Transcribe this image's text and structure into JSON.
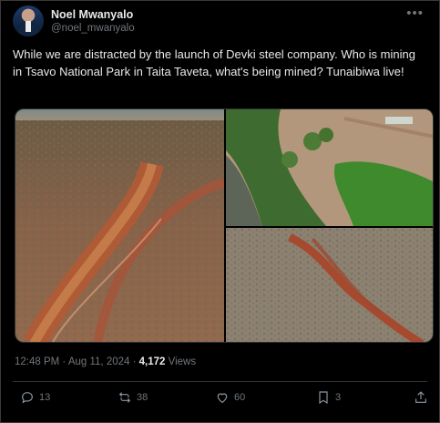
{
  "author": {
    "name": "Noel Mwanyalo",
    "handle": "@noel_mwanyalo"
  },
  "tweet": {
    "text": "While we are distracted by the launch of Devki steel company. Who is mining in Tsavo National Park in Taita Taveta, what's being mined? Tunaibiwa live!"
  },
  "meta": {
    "time": "12:48 PM",
    "date": "Aug 11, 2024",
    "separator": " · ",
    "views_count": "4,172",
    "views_label": " Views"
  },
  "actions": {
    "replies": "13",
    "retweets": "38",
    "likes": "60",
    "bookmarks": "3"
  },
  "icons": {
    "more": "more-dots-icon",
    "reply": "reply-icon",
    "retweet": "retweet-icon",
    "like": "heart-icon",
    "bookmark": "bookmark-icon",
    "share": "share-icon"
  },
  "colors": {
    "background": "#000000",
    "text": "#e7e9ea",
    "muted": "#71767b"
  }
}
